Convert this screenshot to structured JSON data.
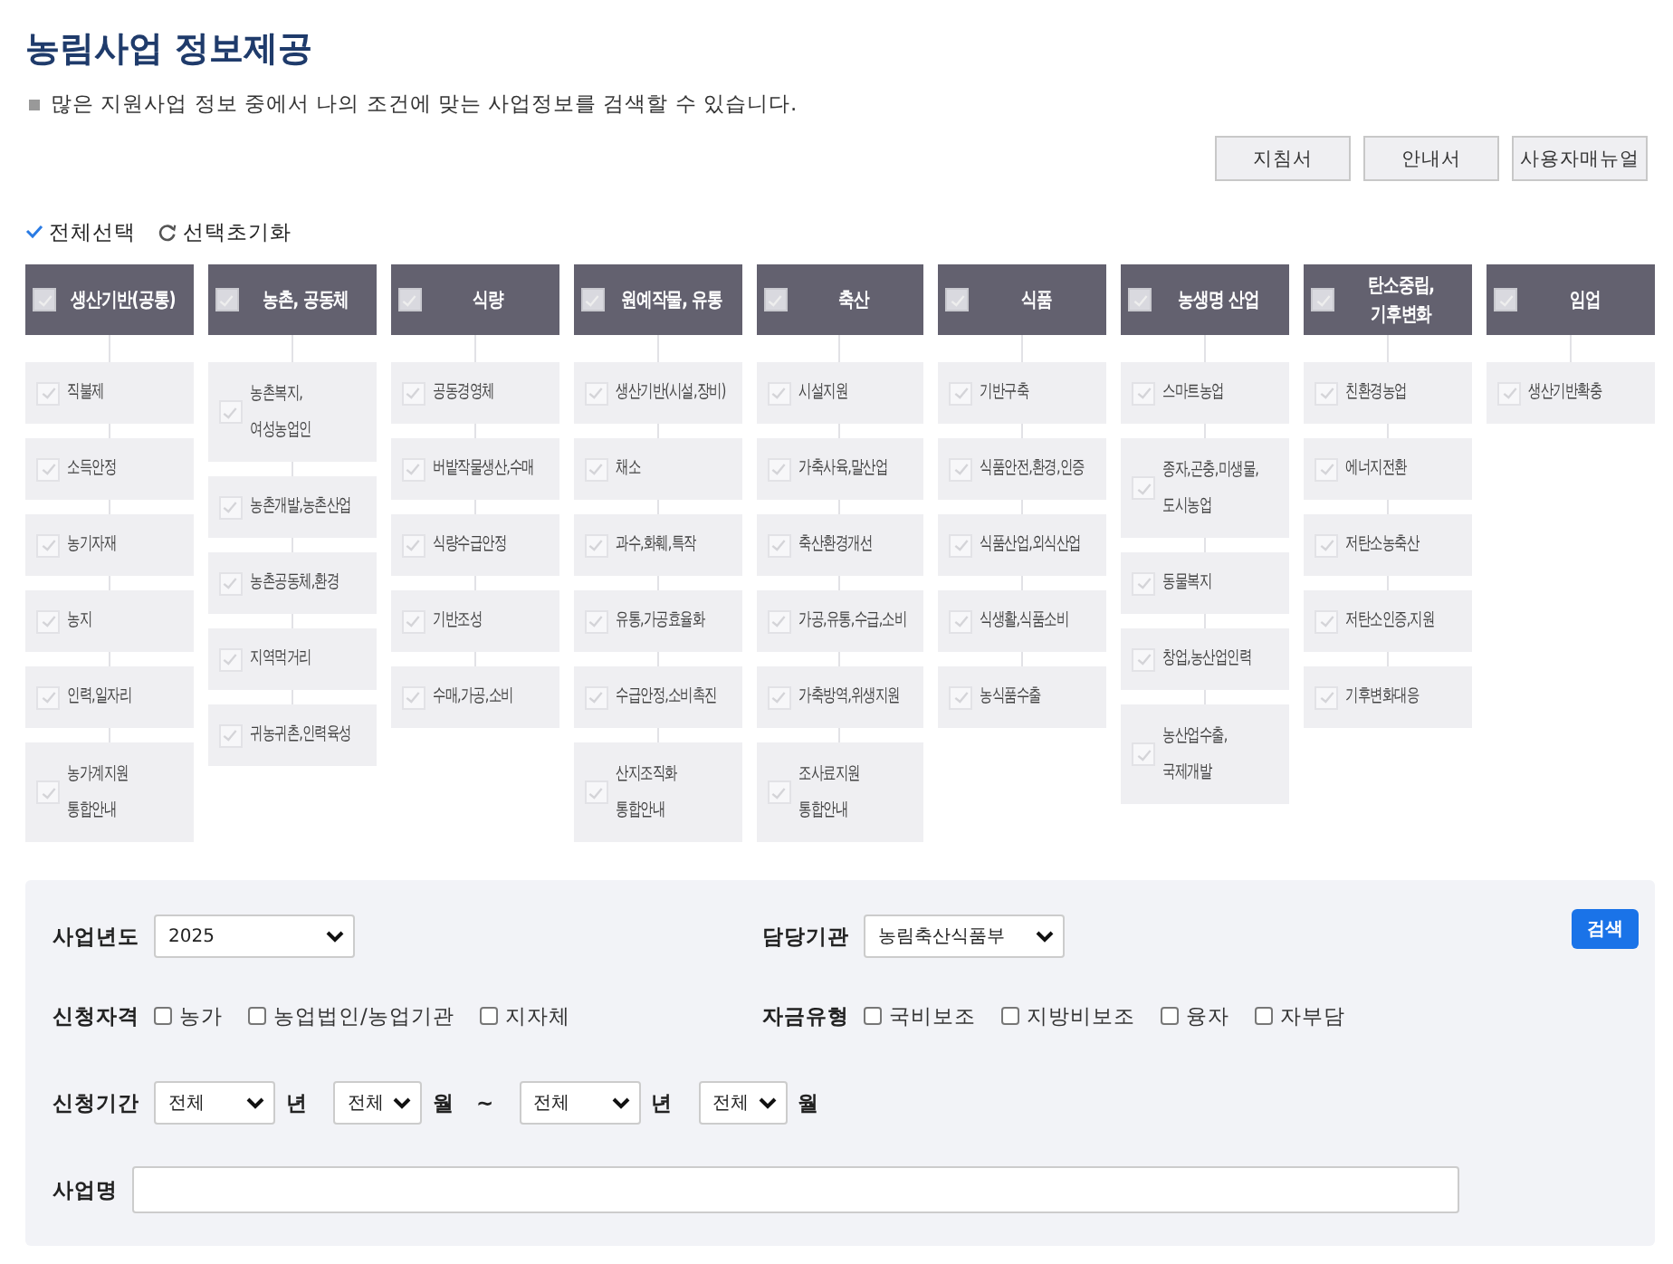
{
  "title": "농림사업 정보제공",
  "description": "많은 지원사업 정보 중에서 나의 조건에 맞는 사업정보를 검색할 수 있습니다.",
  "doc_buttons": [
    "지침서",
    "안내서",
    "사용자매뉴얼"
  ],
  "select_all": "전체선택",
  "reset": "선택초기화",
  "categories": [
    {
      "title": "생산기반(공통)",
      "checked": false,
      "items": [
        {
          "label": "직불제",
          "checked": false
        },
        {
          "label": "소득안정",
          "checked": false
        },
        {
          "label": "농기자재",
          "checked": false
        },
        {
          "label": "농지",
          "checked": false
        },
        {
          "label": "인력,일자리",
          "checked": false
        },
        {
          "label": "농가계지원\n통합안내",
          "checked": false
        }
      ]
    },
    {
      "title": "농촌, 공동체",
      "checked": false,
      "items": [
        {
          "label": "농촌복지,\n여성농업인",
          "checked": false
        },
        {
          "label": "농촌개발,농촌산업",
          "checked": false
        },
        {
          "label": "농촌공동체,환경",
          "checked": false
        },
        {
          "label": "지역먹거리",
          "checked": false
        },
        {
          "label": "귀농귀촌,인력육성",
          "checked": false
        }
      ]
    },
    {
      "title": "식량",
      "checked": false,
      "items": [
        {
          "label": "공동경영체",
          "checked": false
        },
        {
          "label": "버밭작물생산,수매",
          "checked": false
        },
        {
          "label": "식량수급안정",
          "checked": false
        },
        {
          "label": "기반조성",
          "checked": false
        },
        {
          "label": "수매,가공,소비",
          "checked": false
        }
      ]
    },
    {
      "title": "원예작물, 유통",
      "checked": false,
      "items": [
        {
          "label": "생산기반(시설,장비)",
          "checked": false
        },
        {
          "label": "채소",
          "checked": false
        },
        {
          "label": "과수,화훼,특작",
          "checked": false
        },
        {
          "label": "유통,가공효율화",
          "checked": false
        },
        {
          "label": "수급안정,소비촉진",
          "checked": false
        },
        {
          "label": "산지조직화\n통합안내",
          "checked": false
        }
      ]
    },
    {
      "title": "축산",
      "checked": false,
      "items": [
        {
          "label": "시설지원",
          "checked": false
        },
        {
          "label": "가축사육,말산업",
          "checked": false
        },
        {
          "label": "축산환경개선",
          "checked": false
        },
        {
          "label": "가공,유통,수급,소비",
          "checked": false
        },
        {
          "label": "가축방역,위생지원",
          "checked": false
        },
        {
          "label": "조사료지원\n통합안내",
          "checked": false
        }
      ]
    },
    {
      "title": "식품",
      "checked": false,
      "items": [
        {
          "label": "기반구축",
          "checked": false
        },
        {
          "label": "식품안전,환경,인증",
          "checked": false
        },
        {
          "label": "식품산업,외식산업",
          "checked": false
        },
        {
          "label": "식생활,식품소비",
          "checked": false
        },
        {
          "label": "농식품수출",
          "checked": false
        }
      ]
    },
    {
      "title": "농생명 산업",
      "checked": false,
      "items": [
        {
          "label": "스마트농업",
          "checked": false
        },
        {
          "label": "종자,곤충,미생물,\n도시농업",
          "checked": false
        },
        {
          "label": "동물복지",
          "checked": false
        },
        {
          "label": "창업,농산업인력",
          "checked": false
        },
        {
          "label": "농산업수출,\n국제개발",
          "checked": false
        }
      ]
    },
    {
      "title": "탄소중립,\n기후변화",
      "checked": false,
      "items": [
        {
          "label": "친환경농업",
          "checked": false
        },
        {
          "label": "에너지전환",
          "checked": false
        },
        {
          "label": "저탄소농축산",
          "checked": false
        },
        {
          "label": "저탄소인증,지원",
          "checked": false
        },
        {
          "label": "기후변화대응",
          "checked": false
        }
      ]
    },
    {
      "title": "임업",
      "checked": false,
      "items": [
        {
          "label": "생산기반확충",
          "checked": false
        }
      ]
    }
  ],
  "form": {
    "year": {
      "label": "사업년도",
      "value": "2025"
    },
    "agency": {
      "label": "담당기관",
      "value": "농림축산식품부"
    },
    "search_button": "검색",
    "eligibility": {
      "label": "신청자격",
      "options": [
        {
          "label": "농가",
          "checked": false
        },
        {
          "label": "농업법인/농업기관",
          "checked": false
        },
        {
          "label": "지자체",
          "checked": false
        }
      ]
    },
    "fund_type": {
      "label": "자금유형",
      "options": [
        {
          "label": "국비보조",
          "checked": false
        },
        {
          "label": "지방비보조",
          "checked": false
        },
        {
          "label": "융자",
          "checked": false
        },
        {
          "label": "자부담",
          "checked": false
        }
      ]
    },
    "period": {
      "label": "신청기간",
      "from_year": "전체",
      "from_year_unit": "년",
      "from_month": "전체",
      "from_month_unit": "월",
      "separator": "~",
      "to_year": "전체",
      "to_year_unit": "년",
      "to_month": "전체",
      "to_month_unit": "월"
    },
    "name": {
      "label": "사업명"
    }
  }
}
